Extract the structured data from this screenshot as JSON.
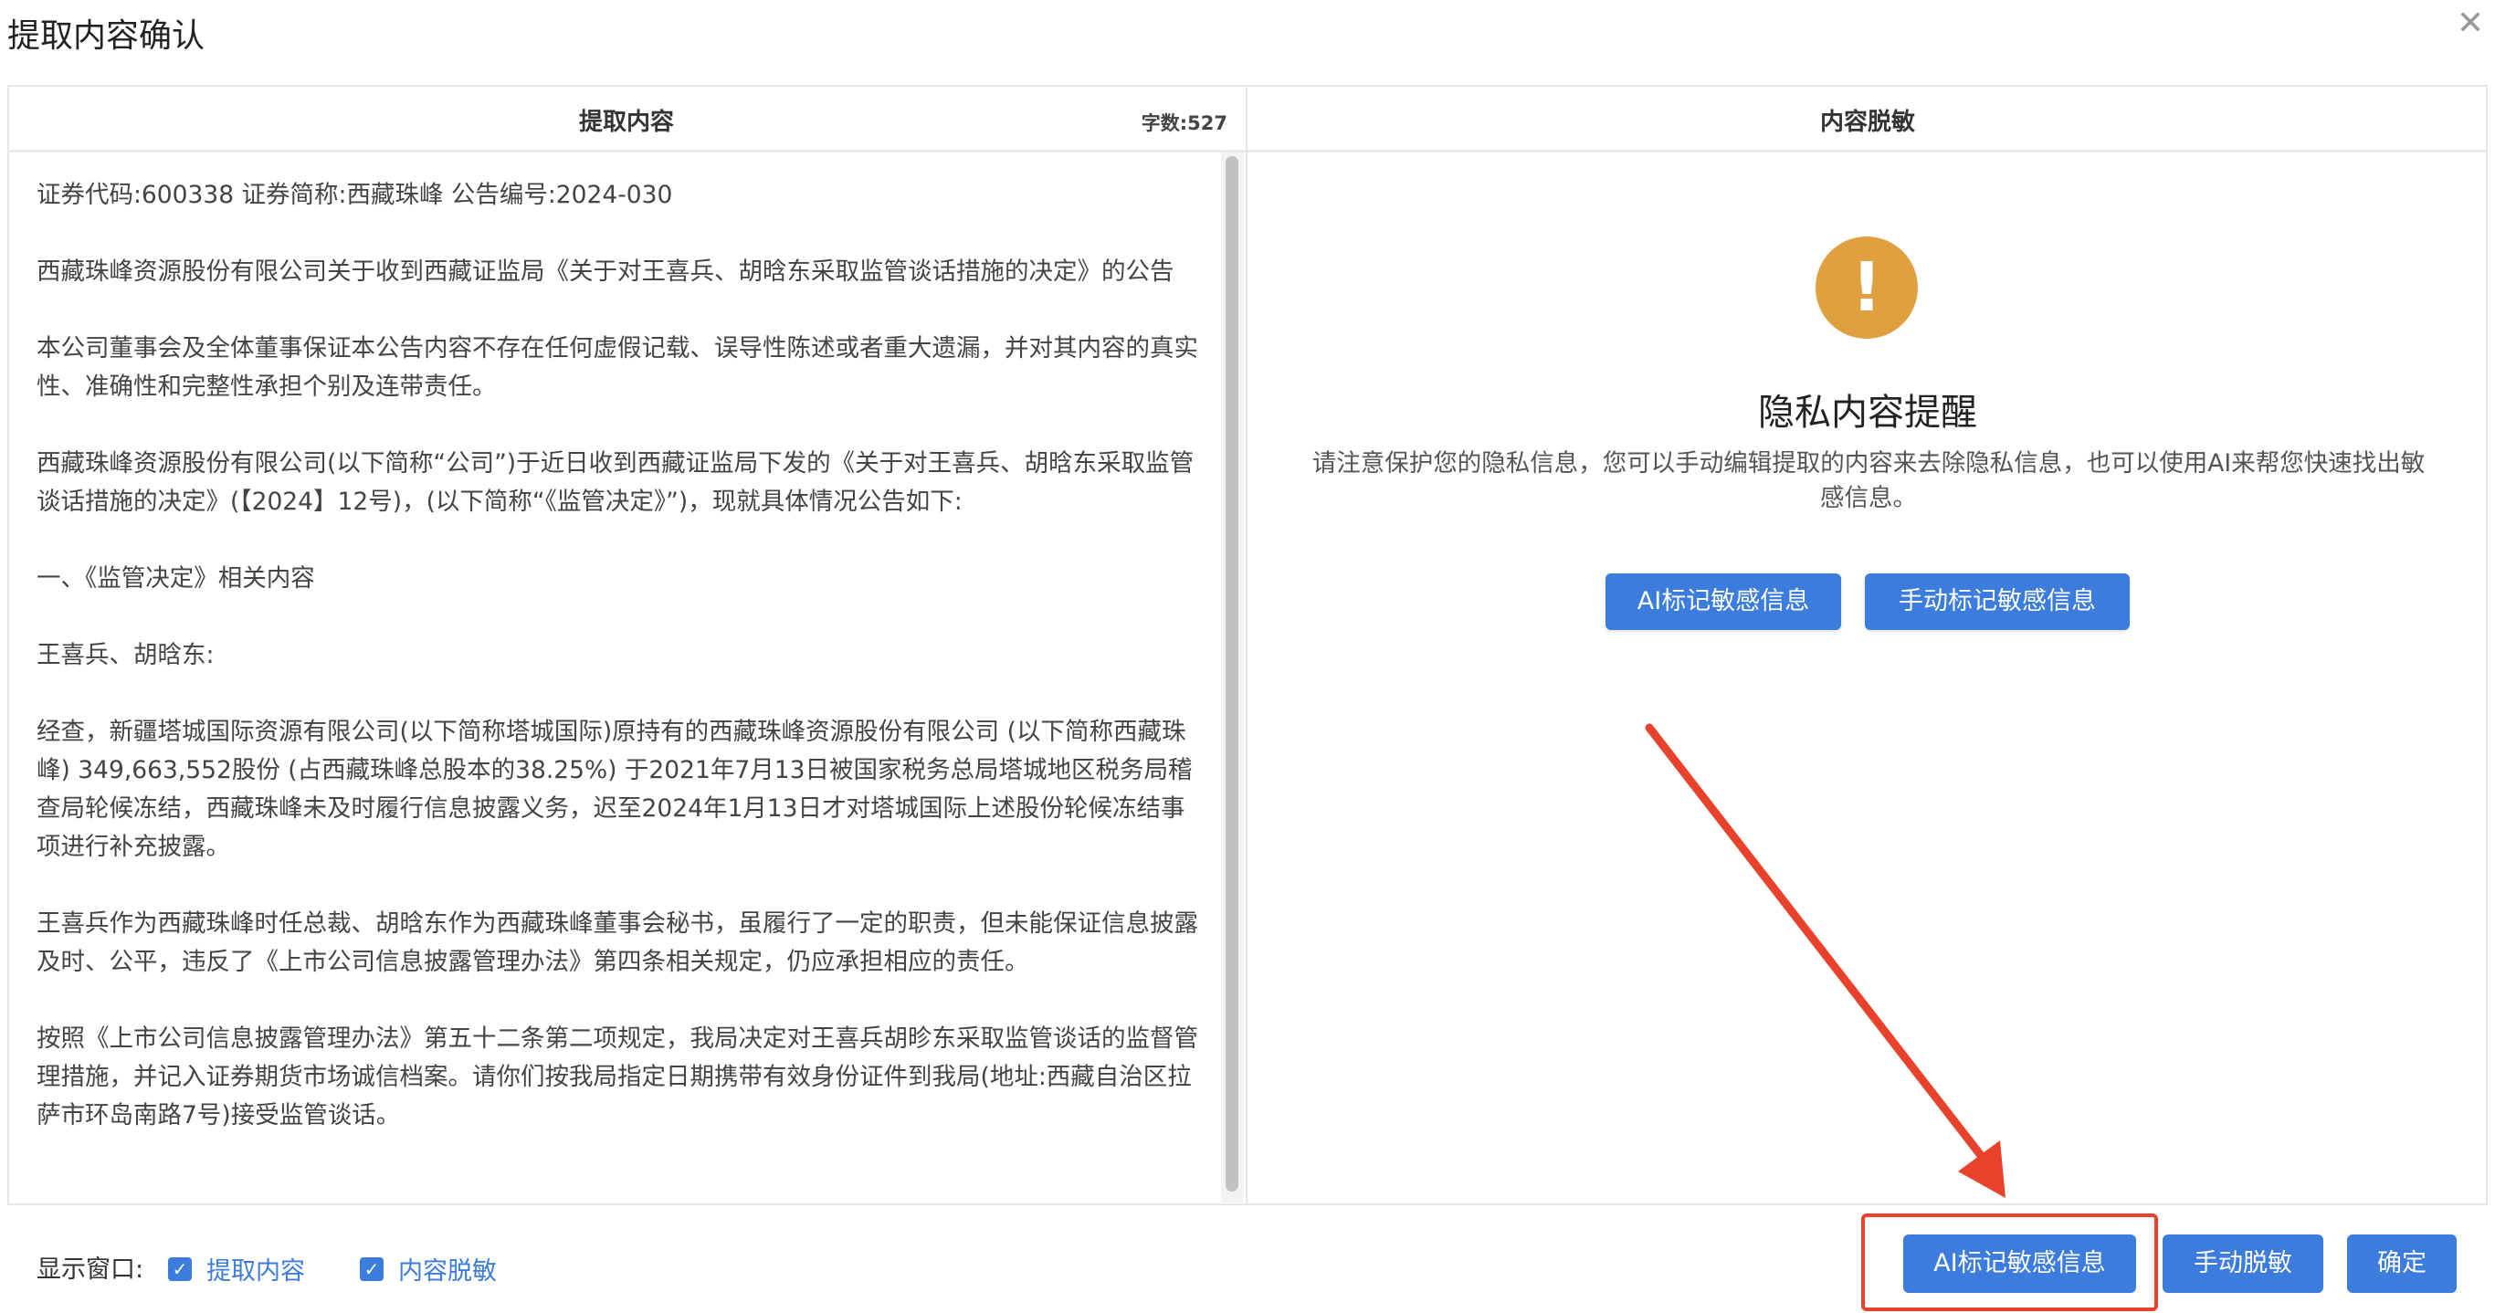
{
  "dialog": {
    "title": "提取内容确认"
  },
  "left_panel": {
    "header": "提取内容",
    "word_count": "字数:527",
    "paragraphs": [
      "证券代码:600338 证券简称:西藏珠峰 公告编号:2024-030",
      "西藏珠峰资源股份有限公司关于收到西藏证监局《关于对王喜兵、胡晗东采取监管谈话措施的决定》的公告",
      "本公司董事会及全体董事保证本公告内容不存在任何虚假记载、误导性陈述或者重大遗漏，并对其内容的真实性、准确性和完整性承担个别及连带责任。",
      "西藏珠峰资源股份有限公司(以下简称“公司”)于近日收到西藏证监局下发的《关于对王喜兵、胡晗东采取监管谈话措施的决定》(【2024】12号)，(以下简称“《监管决定》”)，现就具体情况公告如下:",
      "一、《监管决定》相关内容",
      "王喜兵、胡晗东:",
      "经查，新疆塔城国际资源有限公司(以下简称塔城国际)原持有的西藏珠峰资源股份有限公司 (以下简称西藏珠峰) 349,663,552股份 (占西藏珠峰总股本的38.25%) 于2021年7月13日被国家税务总局塔城地区税务局稽查局轮候冻结，西藏珠峰未及时履行信息披露义务，迟至2024年1月13日才对塔城国际上述股份轮候冻结事项进行补充披露。",
      "王喜兵作为西藏珠峰时任总裁、胡晗东作为西藏珠峰董事会秘书，虽履行了一定的职责，但未能保证信息披露及时、公平，违反了《上市公司信息披露管理办法》第四条相关规定，仍应承担相应的责任。",
      "按照《上市公司信息披露管理办法》第五十二条第二项规定，我局决定对王喜兵胡昣东采取监管谈话的监督管理措施，并记入证券期货市场诚信档案。请你们按我局指定日期携带有效身份证件到我局(地址:西藏自治区拉萨市环岛南路7号)接受监管谈话。"
    ]
  },
  "right_panel": {
    "header": "内容脱敏",
    "icon": "warning-icon",
    "heading": "隐私内容提醒",
    "description": "请注意保护您的隐私信息，您可以手动编辑提取的内容来去除隐私信息，也可以使用AI来帮您快速找出敏感信息。",
    "ai_button": "AI标记敏感信息",
    "manual_button": "手动标记敏感信息"
  },
  "footer": {
    "display_label": "显示窗口:",
    "checkbox_extract": {
      "label": "提取内容",
      "checked": true
    },
    "checkbox_desensitize": {
      "label": "内容脱敏",
      "checked": true
    },
    "ai_button": "AI标记敏感信息",
    "manual_button": "手动脱敏",
    "confirm_button": "确定"
  },
  "colors": {
    "accent": "#3b7cdc",
    "warning": "#e0a040",
    "annotation": "#e8412c"
  }
}
